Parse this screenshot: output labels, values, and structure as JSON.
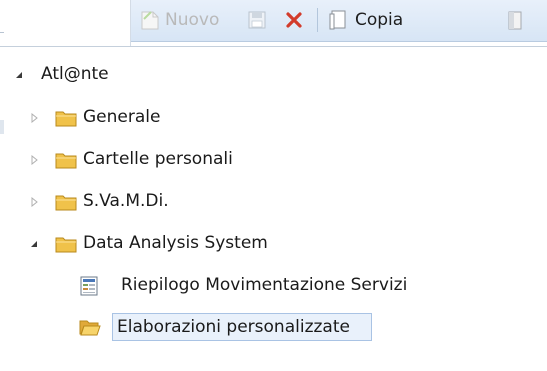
{
  "toolbar": {
    "new_label": "Nuovo",
    "copy_label": "Copia"
  },
  "tree": {
    "root_label": "Atl@nte",
    "items": [
      {
        "label": "Generale"
      },
      {
        "label": "Cartelle personali"
      },
      {
        "label": "S.Va.M.Di."
      },
      {
        "label": "Data Analysis System"
      }
    ],
    "children": [
      {
        "label": "Riepilogo Movimentazione Servizi"
      },
      {
        "label": "Elaborazioni personalizzate"
      }
    ]
  },
  "colors": {
    "folder": "#f0c24a",
    "selection_fill": "#e9f1fb",
    "selection_border": "#a9c3e4",
    "toolbar_bg": "#dde9f6",
    "delete_red": "#d23b2b"
  }
}
